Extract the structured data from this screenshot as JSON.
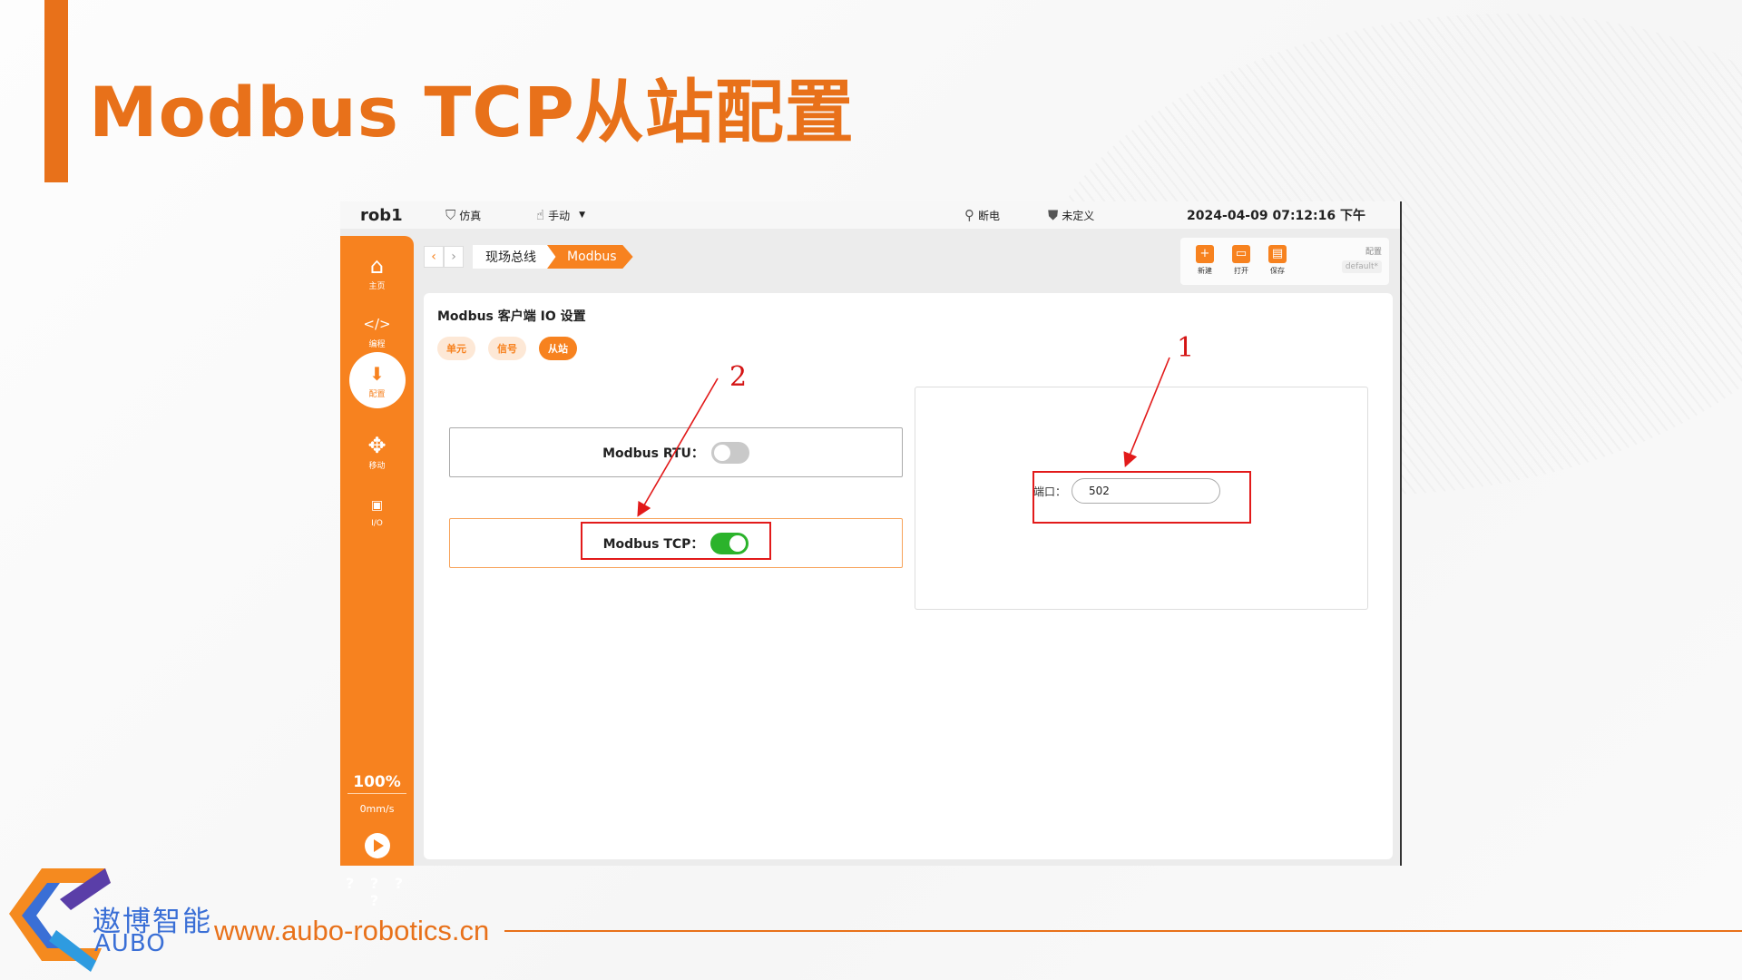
{
  "slide": {
    "title": "Modbus TCP从站配置",
    "accent_color": "#e8711a"
  },
  "app": {
    "robot_name": "rob1",
    "status": {
      "sim_label": "仿真",
      "mode_label": "手动",
      "power_label": "断电",
      "undefined_label": "未定义",
      "datetime": "2024-04-09 07:12:16 下午"
    },
    "sidebar": {
      "items": [
        {
          "label": "主页",
          "icon": "home-icon"
        },
        {
          "label": "编程",
          "icon": "code-icon"
        },
        {
          "label": "配置",
          "icon": "config-icon",
          "active": true
        },
        {
          "label": "移动",
          "icon": "move-icon"
        },
        {
          "label": "I/O",
          "icon": "io-icon"
        }
      ],
      "speed_percent": "100%",
      "speed_mms": "0mm/s",
      "bottom_text": "? ? ? ?"
    },
    "breadcrumb": {
      "level1": "现场总线",
      "level2": "Modbus"
    },
    "toolbar": {
      "new_label": "新建",
      "open_label": "打开",
      "save_label": "保存",
      "config_label": "配置",
      "config_value": "default*"
    },
    "panel": {
      "title": "Modbus 客户端 IO 设置",
      "tabs": [
        "单元",
        "信号",
        "从站"
      ],
      "active_tab": "从站",
      "rtu_label": "Modbus RTU：",
      "rtu_enabled": false,
      "tcp_label": "Modbus TCP：",
      "tcp_enabled": true,
      "port_label": "端口：",
      "port_value": "502"
    },
    "accent_color": "#f7821f"
  },
  "annotations": {
    "label_1": "1",
    "label_2": "2",
    "color": "#e21a1a"
  },
  "footer": {
    "brand_cn": "遨博智能",
    "brand_en": "AUBO",
    "url": "www.aubo-robotics.cn"
  }
}
